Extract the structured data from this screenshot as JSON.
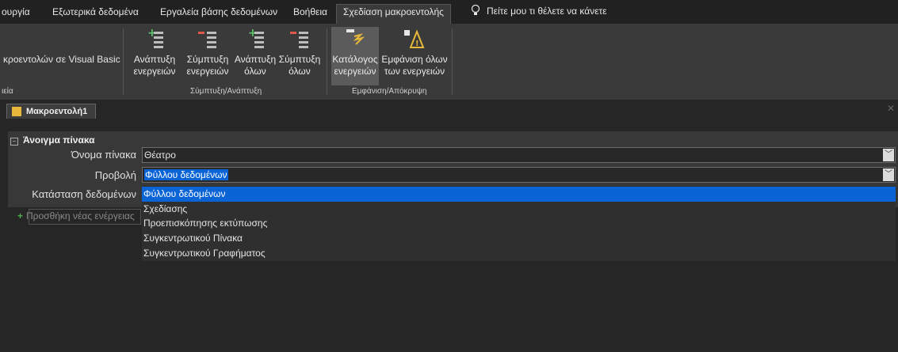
{
  "tabs": [
    "ουργία",
    "Εξωτερικά δεδομένα",
    "Εργαλεία βάσης δεδομένων",
    "Βοήθεια",
    "Σχεδίαση μακροεντολής"
  ],
  "tell_me": "Πείτε μου τι θέλετε να κάνετε",
  "ribbon": {
    "left_label": "κροεντολών σε Visual Basic",
    "left_group": "ιεία",
    "buttons": [
      {
        "line1": "Ανάπτυξη",
        "line2": "ενεργειών",
        "icon": "expand-actions-icon"
      },
      {
        "line1": "Σύμπτυξη",
        "line2": "ενεργειών",
        "icon": "collapse-actions-icon"
      },
      {
        "line1": "Ανάπτυξη",
        "line2": "όλων",
        "icon": "expand-all-icon"
      },
      {
        "line1": "Σύμπτυξη",
        "line2": "όλων",
        "icon": "collapse-all-icon"
      },
      {
        "line1": "Κατάλογος",
        "line2": "ενεργειών",
        "icon": "action-catalog-icon"
      },
      {
        "line1": "Εμφάνιση όλων",
        "line2": "των ενεργειών",
        "icon": "show-all-actions-icon"
      }
    ],
    "group1": "Σύμπτυξη/Ανάπτυξη",
    "group2": "Εμφάνιση/Απόκρυψη"
  },
  "doc_tab": "Μακροεντολή1",
  "block_title": "Άνοιγμα πίνακα",
  "fields": {
    "table_label": "Όνομα πίνακα",
    "table_value": "Θέατρο",
    "view_label": "Προβολή",
    "view_value": "Φύλλου δεδομένων",
    "mode_label": "Κατάσταση δεδομένων"
  },
  "view_options": [
    "Φύλλου δεδομένων",
    "Σχεδίασης",
    "Προεπισκόπησης εκτύπωσης",
    "Συγκεντρωτικού Πίνακα",
    "Συγκεντρωτικού Γραφήματος"
  ],
  "add_action": "Προσθήκη νέας ενέργειας"
}
